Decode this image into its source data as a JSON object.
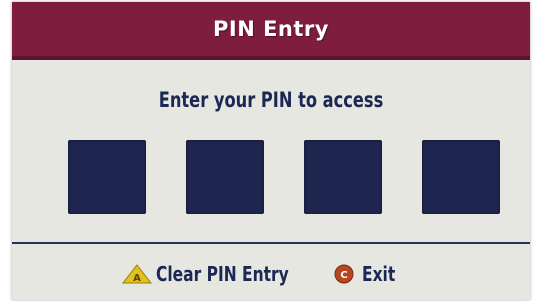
{
  "dialog": {
    "title": "PIN Entry",
    "prompt": "Enter your PIN to access",
    "pin_length": 4,
    "pin_entered": 0
  },
  "footer": {
    "clear": {
      "icon": "a-triangle-button-icon",
      "icon_letter": "A",
      "label": "Clear PIN Entry"
    },
    "exit": {
      "icon": "c-circle-button-icon",
      "icon_letter": "C",
      "label": "Exit"
    }
  },
  "colors": {
    "title_bar": "#7f1d3f",
    "background": "#e7e7e1",
    "pin_box": "#1f2650",
    "text": "#1b2755",
    "a_button": "#e3c11d",
    "c_button": "#b8461f"
  }
}
